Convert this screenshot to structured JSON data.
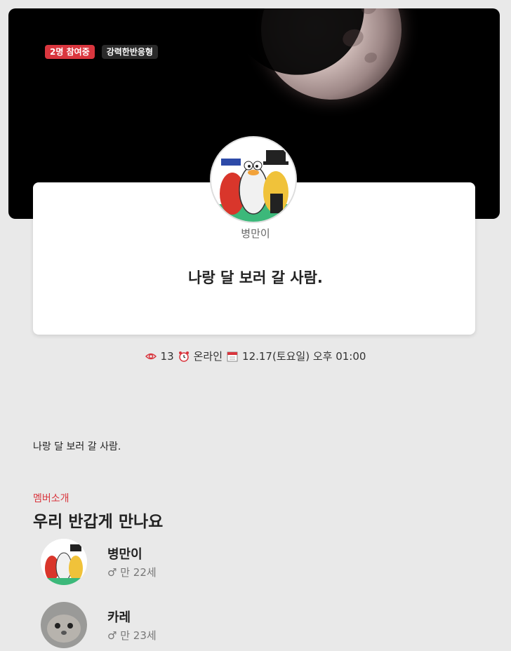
{
  "badges": {
    "participants": "2명 참여중",
    "type": "강력한반응형"
  },
  "host": {
    "name": "병만이"
  },
  "meeting": {
    "title": "나랑 달 보러 갈 사람.",
    "views": "13",
    "mode": "온라인",
    "datetime": "12.17(토요일) 오후 01:00",
    "description": "나랑 달 보러 갈 사람."
  },
  "members_section": {
    "label": "멤버소개",
    "title": "우리 반갑게 만나요",
    "members": [
      {
        "name": "병만이",
        "age": "♂ 만 22세"
      },
      {
        "name": "카레",
        "age": "♂ 만 23세"
      }
    ]
  },
  "colors": {
    "accent": "#d9363e",
    "background": "#e9e9e9"
  },
  "icons": [
    "eye-icon",
    "alarm-clock-icon",
    "calendar-icon"
  ]
}
